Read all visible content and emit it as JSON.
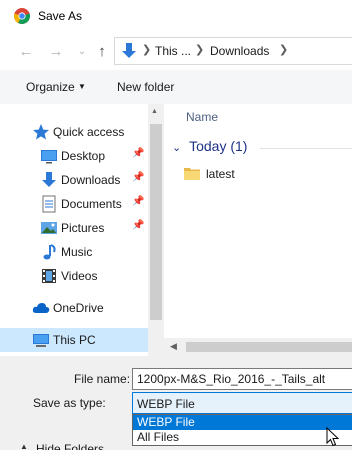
{
  "window": {
    "title": "Save As",
    "app_icon": "chrome-icon"
  },
  "address": {
    "breadcrumbs": [
      "This ...",
      "Downloads"
    ],
    "icon": "download-arrow-icon"
  },
  "toolbar": {
    "organize_label": "Organize",
    "new_folder_label": "New folder"
  },
  "nav": {
    "items": [
      {
        "label": "Quick access",
        "icon": "star-icon",
        "pinned": false
      },
      {
        "label": "Desktop",
        "icon": "desktop-icon",
        "pinned": true
      },
      {
        "label": "Downloads",
        "icon": "download-icon",
        "pinned": true
      },
      {
        "label": "Documents",
        "icon": "documents-icon",
        "pinned": true
      },
      {
        "label": "Pictures",
        "icon": "pictures-icon",
        "pinned": true
      },
      {
        "label": "Music",
        "icon": "music-icon",
        "pinned": false
      },
      {
        "label": "Videos",
        "icon": "videos-icon",
        "pinned": false
      },
      {
        "label": "OneDrive",
        "icon": "cloud-icon",
        "pinned": false
      },
      {
        "label": "This PC",
        "icon": "computer-icon",
        "pinned": false,
        "selected": true
      }
    ]
  },
  "content": {
    "column_header": "Name",
    "group_label": "Today (1)",
    "items": [
      {
        "name": "latest",
        "icon": "folder-icon"
      }
    ]
  },
  "form": {
    "filename_label": "File name:",
    "filename_value": "1200px-M&S_Rio_2016_-_Tails_alt",
    "savetype_label": "Save as type:",
    "savetype_value": "WEBP File",
    "options": [
      "WEBP File",
      "All Files"
    ],
    "highlighted_option": "WEBP File",
    "hide_folders_label": "Hide Folders"
  },
  "colors": {
    "accent": "#0078d7",
    "selection": "#cce8ff"
  }
}
